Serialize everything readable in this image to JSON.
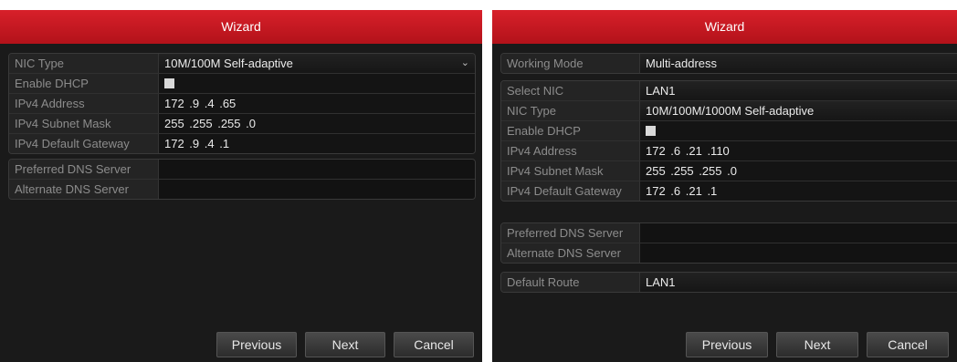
{
  "left": {
    "title": "Wizard",
    "nic_type_label": "NIC Type",
    "nic_type_value": "10M/100M Self-adaptive",
    "dhcp_label": "Enable DHCP",
    "ipv4_label": "IPv4 Address",
    "ipv4_value": "172 .9 .4 .65",
    "mask_label": "IPv4 Subnet Mask",
    "mask_value": "255 .255 .255 .0",
    "gateway_label": "IPv4 Default Gateway",
    "gateway_value": "172 .9 .4 .1",
    "pref_dns_label": "Preferred DNS Server",
    "pref_dns_value": "",
    "alt_dns_label": "Alternate DNS Server",
    "alt_dns_value": "",
    "previous": "Previous",
    "next": "Next",
    "cancel": "Cancel"
  },
  "right": {
    "title": "Wizard",
    "working_mode_label": "Working Mode",
    "working_mode_value": "Multi-address",
    "select_nic_label": "Select NIC",
    "select_nic_value": "LAN1",
    "nic_type_label": "NIC Type",
    "nic_type_value": "10M/100M/1000M Self-adaptive",
    "dhcp_label": "Enable DHCP",
    "ipv4_label": "IPv4 Address",
    "ipv4_value": "172 .6 .21 .110",
    "mask_label": "IPv4 Subnet Mask",
    "mask_value": "255 .255 .255 .0",
    "gateway_label": "IPv4 Default Gateway",
    "gateway_value": "172 .6 .21 .1",
    "pref_dns_label": "Preferred DNS Server",
    "pref_dns_value": "",
    "alt_dns_label": "Alternate DNS Server",
    "alt_dns_value": "",
    "default_route_label": "Default Route",
    "default_route_value": "LAN1",
    "previous": "Previous",
    "next": "Next",
    "cancel": "Cancel"
  },
  "icons": {
    "dropdown": "chevron-down-icon",
    "checkbox": "checkbox-unchecked"
  },
  "colors": {
    "title_bar": "#c8161e",
    "background": "#1a1a1a",
    "label_text": "#8c8c8c",
    "value_text": "#eaeaea"
  }
}
